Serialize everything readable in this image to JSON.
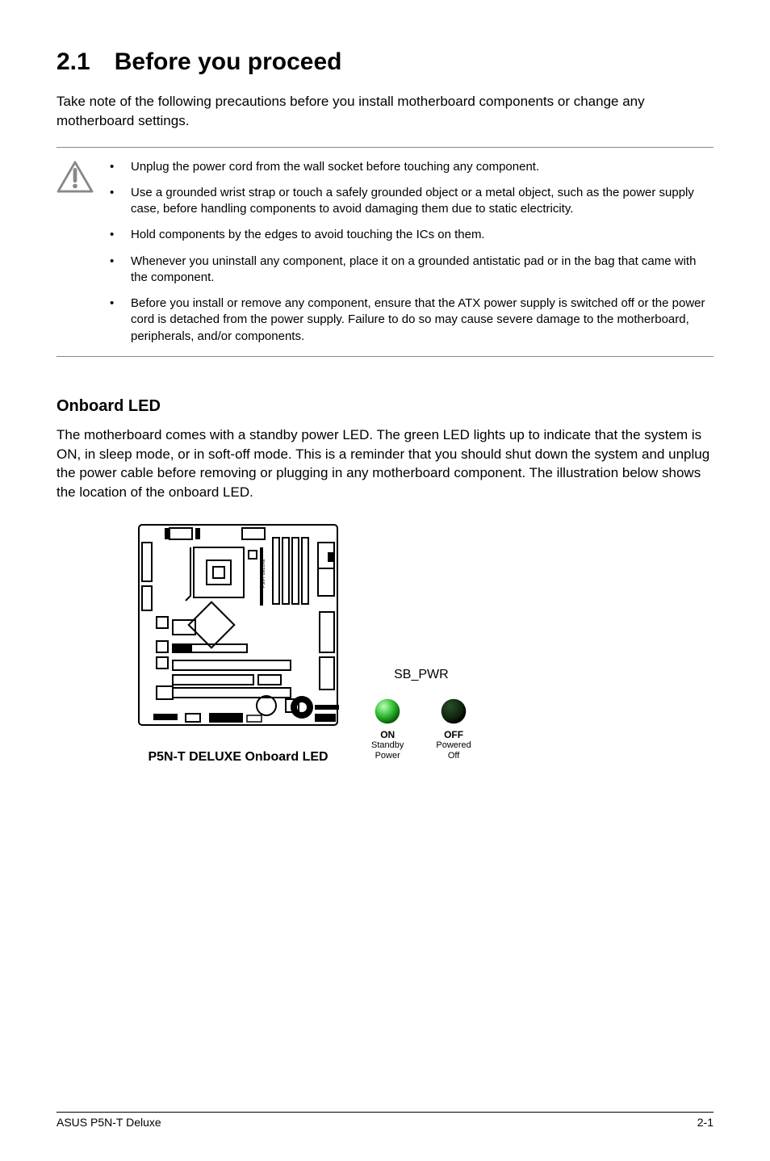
{
  "heading": {
    "number": "2.1",
    "title": "Before you proceed"
  },
  "intro": "Take note of the following precautions before you install motherboard components or change any motherboard settings.",
  "cautions": [
    "Unplug the power cord from the wall socket before touching any component.",
    "Use a grounded wrist strap or touch a safely grounded object or a metal object, such as the power supply case, before handling components to avoid damaging them due to static electricity.",
    "Hold components by the edges to avoid touching the ICs on them.",
    "Whenever you uninstall any component, place it on a grounded antistatic pad or in the bag that came with the component.",
    "Before you install or remove any component, ensure that the ATX power supply is switched off or the power cord is detached from the power supply. Failure to do so may cause severe damage to the motherboard, peripherals, and/or components."
  ],
  "subheading": "Onboard LED",
  "body": "The motherboard comes with a standby power LED. The green LED lights up to indicate that the system is ON, in sleep mode, or in soft-off mode. This is a reminder that you should shut down the system and unplug the power cable before removing or plugging in any motherboard component. The illustration below shows the location of the onboard LED.",
  "figure": {
    "board_caption": "P5N-T DELUXE Onboard LED",
    "board_model_label": "P5N-T DELUXE",
    "led_group_label": "SB_PWR",
    "led_on": {
      "name": "ON",
      "sub1": "Standby",
      "sub2": "Power"
    },
    "led_off": {
      "name": "OFF",
      "sub1": "Powered",
      "sub2": "Off"
    }
  },
  "footer": {
    "left": "ASUS P5N-T Deluxe",
    "right": "2-1"
  }
}
